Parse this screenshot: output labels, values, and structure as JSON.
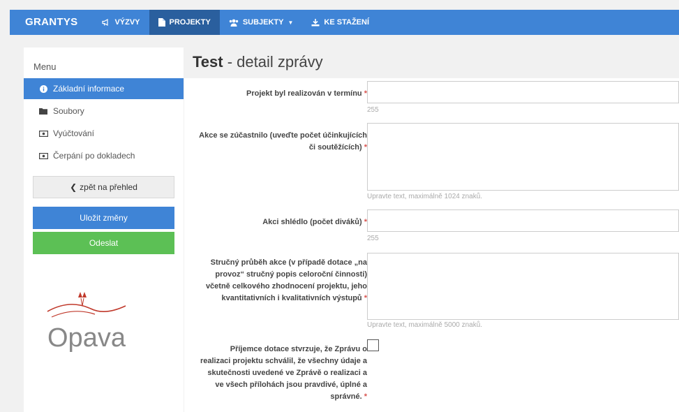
{
  "nav": {
    "brand": "GRANTYS",
    "items": [
      {
        "label": "VÝZVY",
        "icon": "megaphone-icon",
        "active": false
      },
      {
        "label": "PROJEKTY",
        "icon": "document-icon",
        "active": true
      },
      {
        "label": "SUBJEKTY",
        "icon": "users-icon",
        "active": false
      },
      {
        "label": "KE STAŽENÍ",
        "icon": "download-icon",
        "active": false
      }
    ]
  },
  "sidebar": {
    "menu_title": "Menu",
    "items": [
      {
        "label": "Základní informace",
        "icon": "info-icon",
        "active": true
      },
      {
        "label": "Soubory",
        "icon": "folder-icon",
        "active": false
      },
      {
        "label": "Vyúčtování",
        "icon": "money-icon",
        "active": false
      },
      {
        "label": "Čerpání po dokladech",
        "icon": "money-icon",
        "active": false
      }
    ],
    "back_label": "zpět na přehled",
    "save_label": "Uložit změny",
    "send_label": "Odeslat",
    "logo_text": "Opava"
  },
  "page": {
    "title_bold": "Test",
    "title_rest": " - detail zprávy"
  },
  "form": {
    "fields": [
      {
        "label": "Projekt byl realizován v termínu",
        "required": "*",
        "value": "",
        "hint": "255"
      },
      {
        "label": "Akce se zúčastnilo (uveďte počet účinkujících či soutěžících)",
        "required": "*",
        "value": "",
        "hint": "Upravte text, maximálně 1024 znaků."
      },
      {
        "label": "Akci shlédlo (počet diváků)",
        "required": "*",
        "value": "",
        "hint": "255"
      },
      {
        "label": "Stručný průběh akce (v případě dotace „na provoz“ stručný popis celoroční činnosti) včetně celkového zhodnocení projektu, jeho kvantitativních i kvalitativních výstupů",
        "required": "*",
        "value": "",
        "hint": "Upravte text, maximálně 5000 znaků."
      },
      {
        "label": "Příjemce dotace stvrzuje, že Zprávu o realizaci projektu schválil, že všechny údaje a skutečnosti uvedené ve Zprávě o realizaci a ve všech přílohách jsou pravdivé, úplné a správné.",
        "required": "*",
        "checked": false
      }
    ]
  },
  "colors": {
    "primary": "#3f84d6",
    "active_nav": "#2a5f9e",
    "success": "#5cc055",
    "required": "#d9534f"
  }
}
